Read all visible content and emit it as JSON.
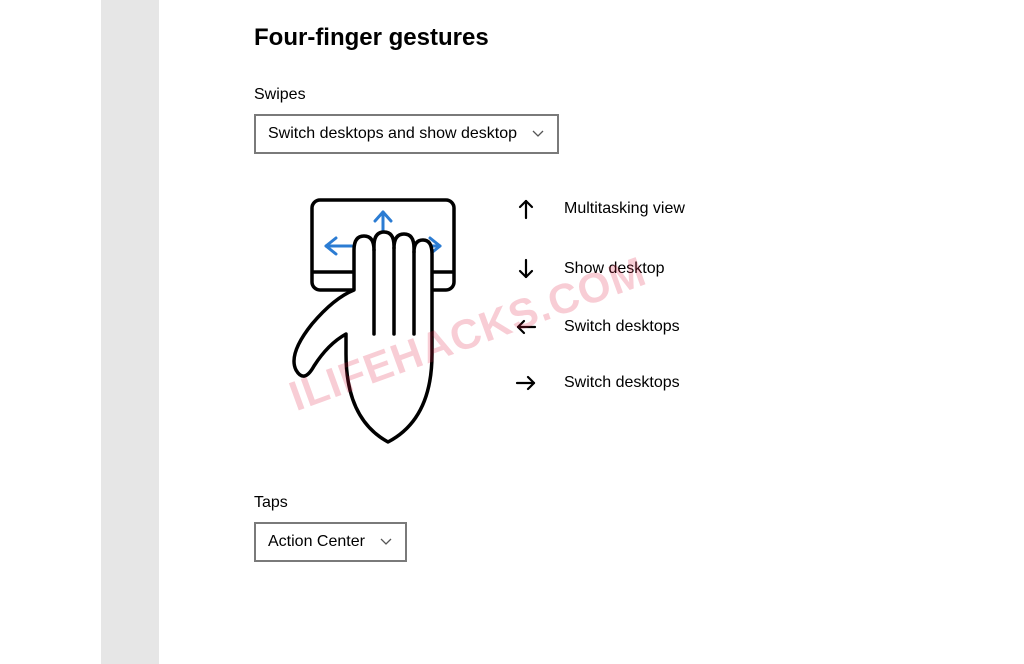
{
  "section": {
    "title": "Four-finger gestures",
    "swipes": {
      "label": "Swipes",
      "selected": "Switch desktops and show desktop"
    },
    "legend": {
      "up": "Multitasking view",
      "down": "Show desktop",
      "left": "Switch desktops",
      "right": "Switch desktops"
    },
    "taps": {
      "label": "Taps",
      "selected": "Action Center"
    }
  },
  "watermark": "ILIFEHACKS.COM"
}
